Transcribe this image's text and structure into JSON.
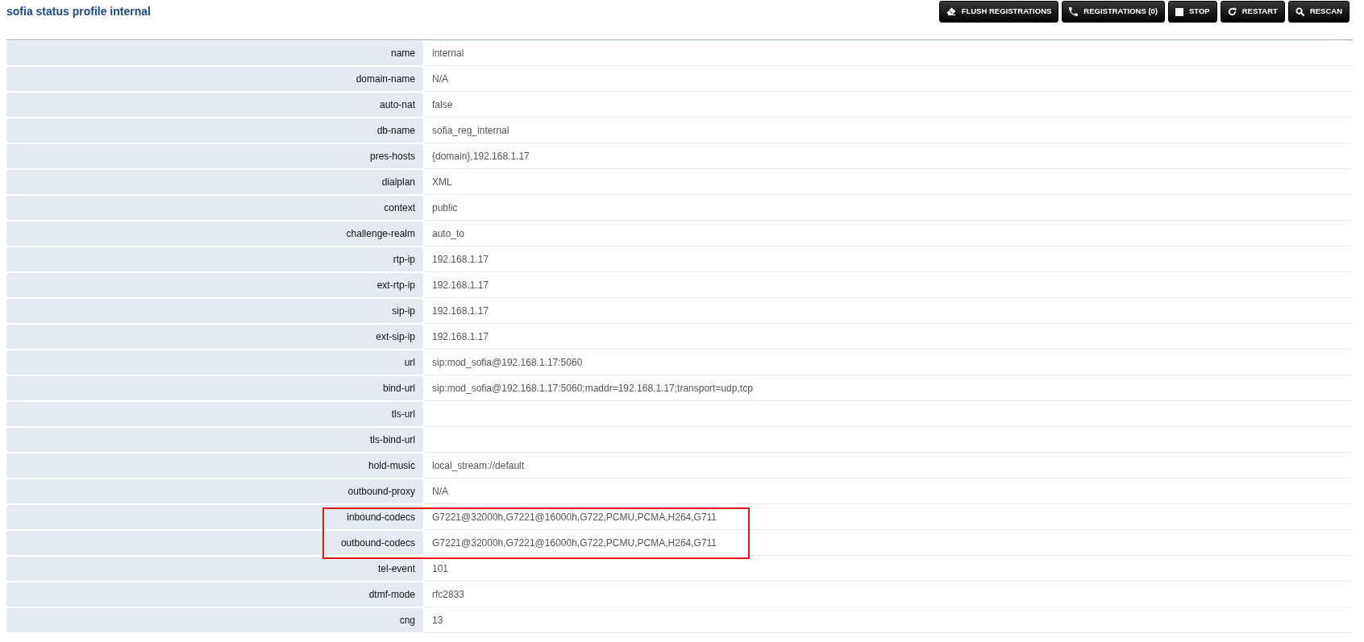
{
  "header": {
    "title": "sofia status profile internal"
  },
  "buttons": [
    {
      "label": "FLUSH REGISTRATIONS"
    },
    {
      "label": "REGISTRATIONS (0)"
    },
    {
      "label": "STOP"
    },
    {
      "label": "RESTART"
    },
    {
      "label": "RESCAN"
    }
  ],
  "rows": [
    {
      "label": "name",
      "value": "internal",
      "highlighted": false
    },
    {
      "label": "domain-name",
      "value": "N/A",
      "highlighted": false
    },
    {
      "label": "auto-nat",
      "value": "false",
      "highlighted": false
    },
    {
      "label": "db-name",
      "value": "sofia_reg_internal",
      "highlighted": false
    },
    {
      "label": "pres-hosts",
      "value": "{domain},192.168.1.17",
      "highlighted": false
    },
    {
      "label": "dialplan",
      "value": "XML",
      "highlighted": false
    },
    {
      "label": "context",
      "value": "public",
      "highlighted": false
    },
    {
      "label": "challenge-realm",
      "value": "auto_to",
      "highlighted": false
    },
    {
      "label": "rtp-ip",
      "value": "192.168.1.17",
      "highlighted": false
    },
    {
      "label": "ext-rtp-ip",
      "value": "192.168.1.17",
      "highlighted": false
    },
    {
      "label": "sip-ip",
      "value": "192.168.1.17",
      "highlighted": false
    },
    {
      "label": "ext-sip-ip",
      "value": "192.168.1.17",
      "highlighted": false
    },
    {
      "label": "url",
      "value": "sip:mod_sofia@192.168.1.17:5060",
      "highlighted": false
    },
    {
      "label": "bind-url",
      "value": "sip:mod_sofia@192.168.1.17:5060;maddr=192.168.1.17;transport=udp,tcp",
      "highlighted": false
    },
    {
      "label": "tls-url",
      "highlighted": false
    },
    {
      "label": "tls-bind-url",
      "highlighted": false
    },
    {
      "label": "hold-music",
      "value": "local_stream://default",
      "highlighted": false
    },
    {
      "label": "outbound-proxy",
      "value": "N/A",
      "highlighted": false
    },
    {
      "label": "inbound-codecs",
      "value": "G7221@32000h,G7221@16000h,G722,PCMU,PCMA,H264,G711",
      "highlighted": true
    },
    {
      "label": "outbound-codecs",
      "value": "G7221@32000h,G7221@16000h,G722,PCMU,PCMA,H264,G711",
      "highlighted": true
    },
    {
      "label": "tel-event",
      "value": "101",
      "highlighted": false
    },
    {
      "label": "dtmf-mode",
      "value": "rfc2833",
      "highlighted": false
    },
    {
      "label": "cng",
      "value": "13",
      "highlighted": false
    }
  ]
}
